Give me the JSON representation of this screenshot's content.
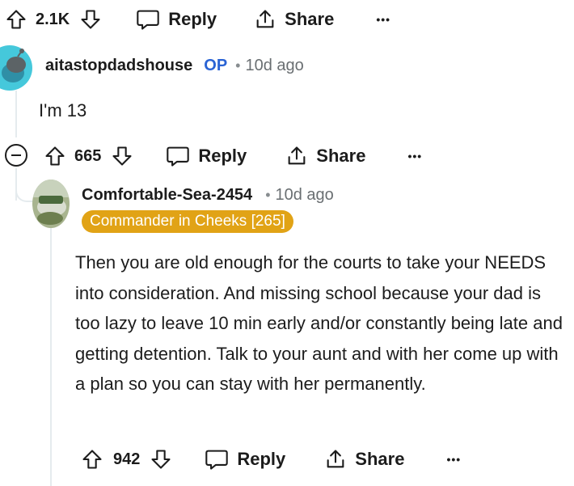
{
  "top_actions": {
    "vote_count": "2.1K",
    "reply_label": "Reply",
    "share_label": "Share",
    "more_label": "•••"
  },
  "comment1": {
    "author": "aitastopdadshouse",
    "op_badge": "OP",
    "separator": "•",
    "time": "10d ago",
    "text": "I'm 13",
    "vote_count": "665",
    "reply_label": "Reply",
    "share_label": "Share",
    "more_label": "•••"
  },
  "comment2": {
    "author": "Comfortable-Sea-2454",
    "separator": "•",
    "time": "10d ago",
    "flair": "Commander in Cheeks [265]",
    "text": "Then you are old enough for the courts to take your NEEDS into consideration. And missing school because your dad is too lazy to leave 10 min early and/or constantly being late and getting detention. Talk to your aunt and with her come up with a plan so you can stay with her permanently.",
    "vote_count": "942",
    "reply_label": "Reply",
    "share_label": "Share",
    "more_label": "•••"
  },
  "colors": {
    "op_blue": "#2a63d4",
    "flair_bg": "#e1a316",
    "avatar1_bg": "#45c8db",
    "thread_line": "#e5ebee"
  }
}
